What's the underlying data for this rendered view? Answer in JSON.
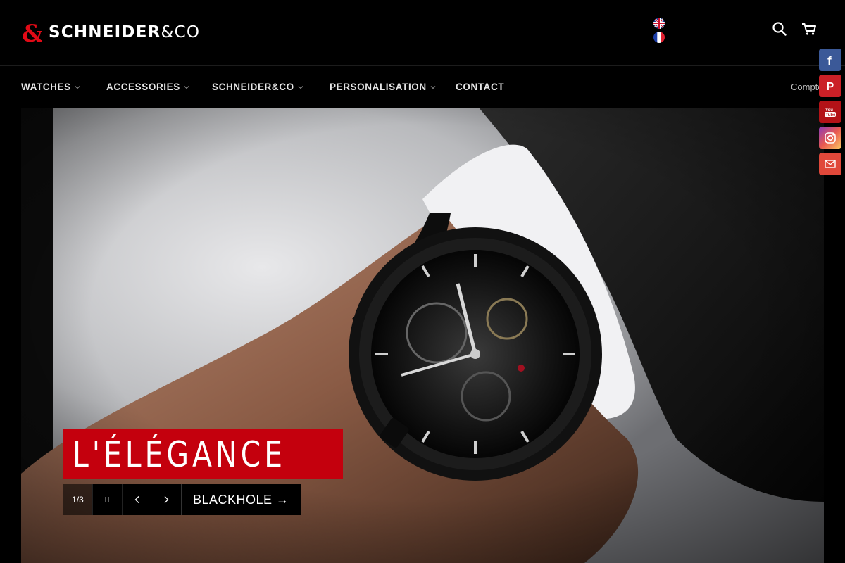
{
  "brand": {
    "mark": "&",
    "name": "SCHNEIDER",
    "suffix": "&CO",
    "accent": "#e10a16"
  },
  "header": {
    "languages": [
      {
        "code": "en",
        "icon": "uk-flag-icon"
      },
      {
        "code": "fr",
        "icon": "france-flag-icon"
      }
    ],
    "search_icon": "search-icon",
    "cart_icon": "cart-icon"
  },
  "nav": {
    "items": [
      {
        "label": "WATCHES",
        "dropdown": true
      },
      {
        "label": "ACCESSORIES",
        "dropdown": true
      },
      {
        "label": "SCHNEIDER&CO",
        "dropdown": true
      },
      {
        "label": "PERSONALISATION",
        "dropdown": true
      },
      {
        "label": "CONTACT",
        "dropdown": false
      }
    ],
    "account": "Compte"
  },
  "hero": {
    "title": "L'ÉLÉGANCE",
    "counter": "1/3",
    "pause": "II",
    "link": "BLACKHOLE →",
    "title_bg": "#c4000d"
  },
  "social": [
    {
      "name": "facebook",
      "icon": "facebook-icon",
      "color": "#3b5998"
    },
    {
      "name": "pinterest",
      "icon": "pinterest-icon",
      "color": "#cb2027"
    },
    {
      "name": "youtube",
      "icon": "youtube-icon",
      "color": "#b31217"
    },
    {
      "name": "instagram",
      "icon": "instagram-icon",
      "color": "#d6249f"
    },
    {
      "name": "email",
      "icon": "email-icon",
      "color": "#e0483a"
    }
  ]
}
